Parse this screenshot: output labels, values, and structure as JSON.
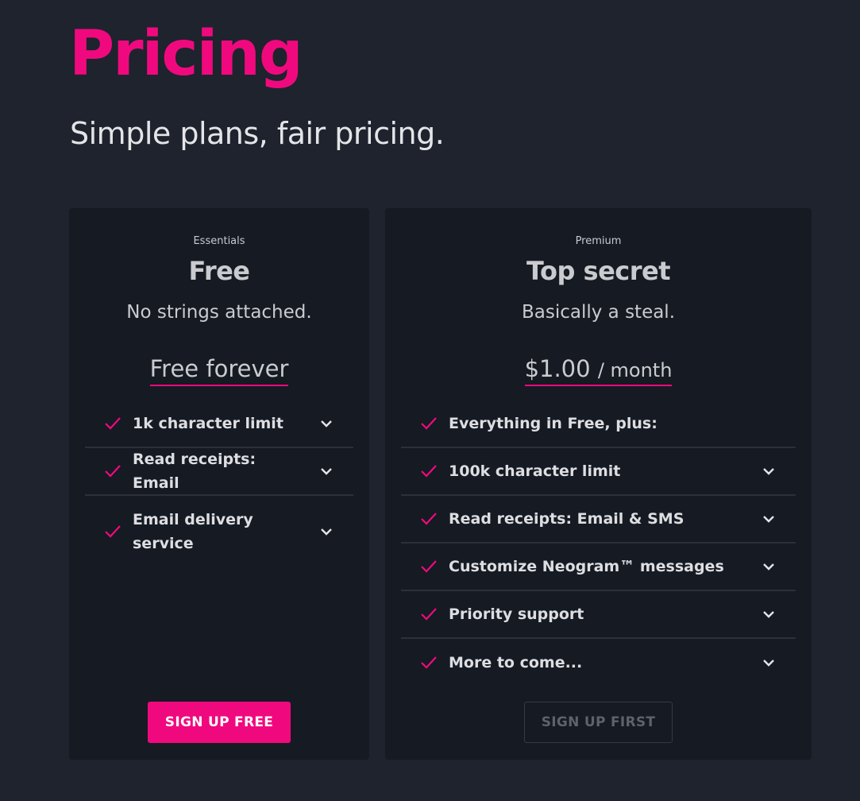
{
  "hero": {
    "title": "Pricing",
    "subtitle": "Simple plans, fair pricing."
  },
  "colors": {
    "accent": "#f0097e",
    "background": "#1e232d",
    "card": "#161a22"
  },
  "plans": [
    {
      "eyebrow": "Essentials",
      "name": "Free",
      "tagline": "No strings attached.",
      "price": "Free forever",
      "features": [
        {
          "label": "1k character limit",
          "expandable": true
        },
        {
          "label": "Read receipts: Email",
          "expandable": true
        },
        {
          "label": "Email delivery service",
          "expandable": true
        }
      ],
      "cta": "SIGN UP FREE"
    },
    {
      "eyebrow": "Premium",
      "name": "Top secret",
      "tagline": "Basically a steal.",
      "price": "$1.00",
      "price_period": "/ month",
      "features": [
        {
          "label": "Everything in Free, plus:",
          "expandable": false
        },
        {
          "label": "100k character limit",
          "expandable": true
        },
        {
          "label": "Read receipts: Email & SMS",
          "expandable": true
        },
        {
          "label": "Customize Neogram™ messages",
          "expandable": true
        },
        {
          "label": "Priority support",
          "expandable": true
        },
        {
          "label": "More to come...",
          "expandable": true
        }
      ],
      "cta": "SIGN UP FIRST"
    }
  ]
}
